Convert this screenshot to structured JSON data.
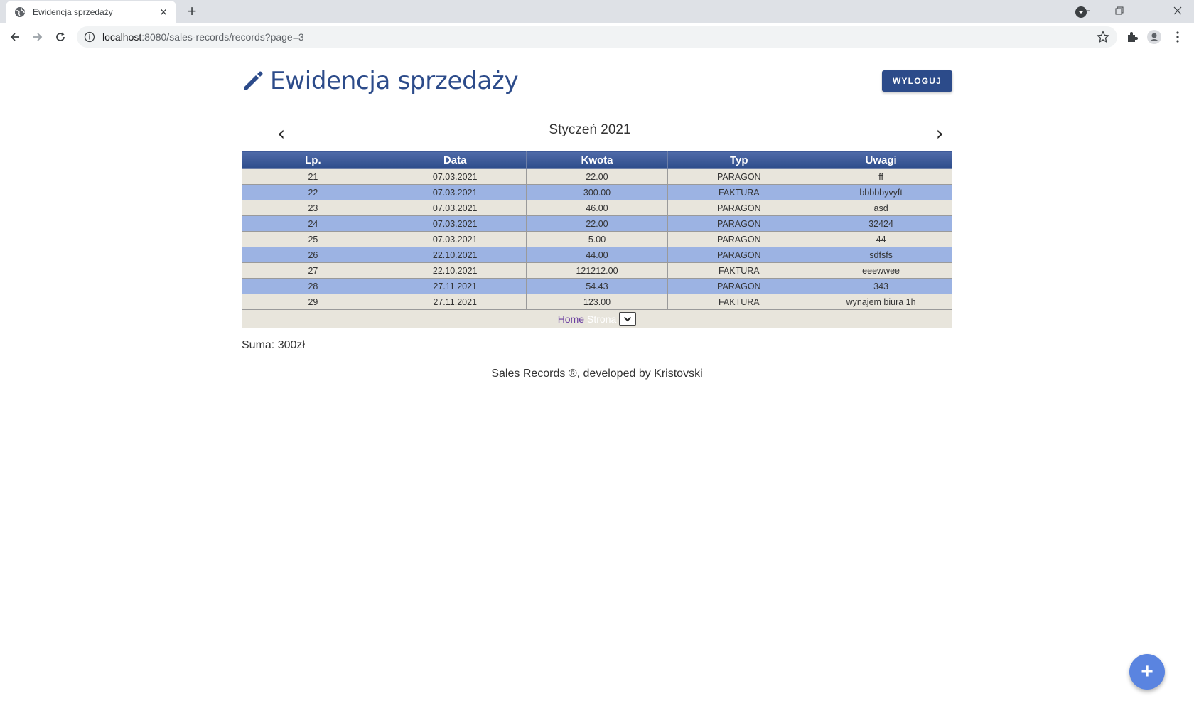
{
  "browser": {
    "tab_title": "Ewidencja sprzedaży",
    "url_host": "localhost",
    "url_rest": ":8080/sales-records/records?page=3"
  },
  "header": {
    "title": "Ewidencja sprzedaży",
    "logout_label": "WYLOGUJ"
  },
  "month_nav": {
    "prev": "‹",
    "label": "Styczeń 2021",
    "next": "›"
  },
  "table": {
    "columns": [
      "Lp.",
      "Data",
      "Kwota",
      "Typ",
      "Uwagi"
    ],
    "rows": [
      [
        "21",
        "07.03.2021",
        "22.00",
        "PARAGON",
        "ff"
      ],
      [
        "22",
        "07.03.2021",
        "300.00",
        "FAKTURA",
        "bbbbbyvyft"
      ],
      [
        "23",
        "07.03.2021",
        "46.00",
        "PARAGON",
        "asd"
      ],
      [
        "24",
        "07.03.2021",
        "22.00",
        "PARAGON",
        "32424"
      ],
      [
        "25",
        "07.03.2021",
        "5.00",
        "PARAGON",
        "44"
      ],
      [
        "26",
        "22.10.2021",
        "44.00",
        "PARAGON",
        "sdfsfs"
      ],
      [
        "27",
        "22.10.2021",
        "121212.00",
        "FAKTURA",
        "eeewwee"
      ],
      [
        "28",
        "27.11.2021",
        "54.43",
        "PARAGON",
        "343"
      ],
      [
        "29",
        "27.11.2021",
        "123.00",
        "FAKTURA",
        "wynajem biura 1h"
      ]
    ]
  },
  "pager": {
    "home": "Home",
    "page_label": "Strona"
  },
  "summary": {
    "text": "Suma: 300zł"
  },
  "footer": {
    "text": "Sales Records ®, developed by Kristovski"
  },
  "fab": {
    "label": "+"
  },
  "colors": {
    "primary": "#2c4b8a",
    "row_odd": "#e8e5dc",
    "row_even": "#9cb3e3",
    "fab": "#5a84e0"
  }
}
